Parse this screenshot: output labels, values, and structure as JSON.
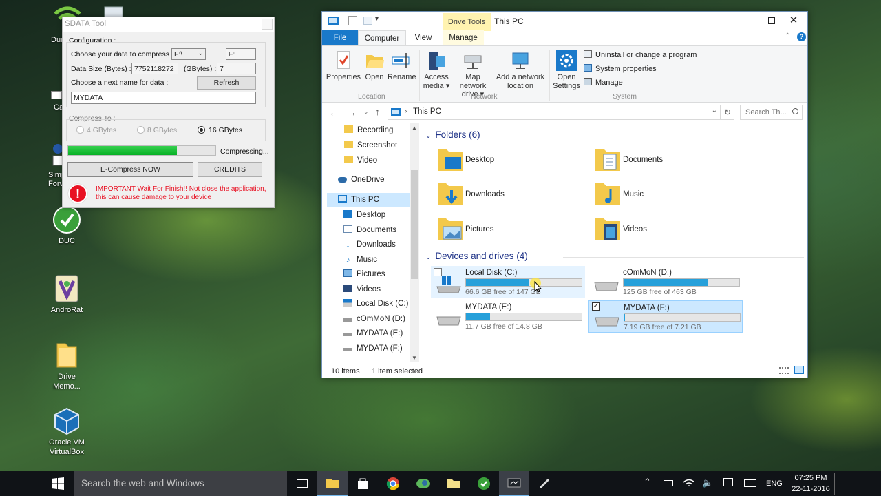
{
  "desktop": {
    "icons": [
      {
        "name": "desktop-icon-duc",
        "label": "DUC"
      },
      {
        "name": "desktop-icon-androrat",
        "label": "AndroRat"
      },
      {
        "name": "desktop-icon-drive-memo",
        "label": "Drive Memo..."
      },
      {
        "name": "desktop-icon-virtualbox",
        "label": "Oracle VM VirtualBox"
      }
    ],
    "clipped_labels": [
      "Dui",
      "Ca",
      "Simp",
      "Forv"
    ]
  },
  "sdata": {
    "title": "SDATA Tool",
    "config_label": "Configuration :",
    "choose_data_label": "Choose your data to compress :",
    "drive_select": "F:\\",
    "drive_box": "F:",
    "data_size_label": "Data Size (Bytes) :",
    "data_size_value": "7752118272",
    "gbytes_label": "(GBytes) :",
    "gbytes_value": "7",
    "next_name_label": "Choose a next name for data :",
    "refresh_label": "Refresh",
    "name_value": "MYDATA",
    "compress_to_label": "Compress To :",
    "options": [
      "4 GBytes",
      "8 GBytes",
      "16 GBytes"
    ],
    "selected_option": "16 GBytes",
    "progress": 0.74,
    "progress_status": "Compressing...",
    "compress_button": "E-Compress NOW",
    "credits_button": "CREDITS",
    "warning": "IMPORTANT Wait For Finish!! Not close the application, this can cause damage to your device",
    "colors": {
      "progress": "#06b025",
      "warning": "#e81123"
    }
  },
  "explorer": {
    "title": "This PC",
    "context_tab": "Drive Tools",
    "tabs": {
      "file": "File",
      "computer": "Computer",
      "view": "View",
      "manage": "Manage"
    },
    "ribbon": {
      "properties": "Properties",
      "open": "Open",
      "rename": "Rename",
      "access_media": "Access media",
      "map_network_drive": "Map network drive",
      "add_network_location": "Add a network location",
      "open_settings": "Open Settings",
      "uninstall": "Uninstall or change a program",
      "system_properties": "System properties",
      "manage": "Manage",
      "group_location": "Location",
      "group_network": "Network",
      "group_system": "System"
    },
    "address": "This PC",
    "search_placeholder": "Search Th...",
    "nav": [
      {
        "label": "Recording",
        "icon": "folder-icon"
      },
      {
        "label": "Screenshot",
        "icon": "folder-icon"
      },
      {
        "label": "Video",
        "icon": "folder-icon"
      },
      {
        "label": "OneDrive",
        "icon": "cloud-icon"
      },
      {
        "label": "This PC",
        "icon": "computer-icon"
      },
      {
        "label": "Desktop",
        "icon": "desktop-icon"
      },
      {
        "label": "Documents",
        "icon": "documents-icon"
      },
      {
        "label": "Downloads",
        "icon": "download-icon"
      },
      {
        "label": "Music",
        "icon": "music-icon"
      },
      {
        "label": "Pictures",
        "icon": "pictures-icon"
      },
      {
        "label": "Videos",
        "icon": "videos-icon"
      },
      {
        "label": "Local Disk (C:)",
        "icon": "disk-icon"
      },
      {
        "label": "cOmMoN (D:)",
        "icon": "drive-icon"
      },
      {
        "label": "MYDATA (E:)",
        "icon": "drive-icon"
      },
      {
        "label": "MYDATA (F:)",
        "icon": "drive-icon"
      }
    ],
    "folders_header": "Folders (6)",
    "folders": [
      {
        "label": "Desktop",
        "icon": "desktop-folder-icon"
      },
      {
        "label": "Documents",
        "icon": "documents-folder-icon"
      },
      {
        "label": "Downloads",
        "icon": "downloads-folder-icon"
      },
      {
        "label": "Music",
        "icon": "music-folder-icon"
      },
      {
        "label": "Pictures",
        "icon": "pictures-folder-icon"
      },
      {
        "label": "Videos",
        "icon": "videos-folder-icon"
      }
    ],
    "drives_header": "Devices and drives (4)",
    "drives": [
      {
        "label": "Local Disk (C:)",
        "free": "66.6 GB free of 147 GB",
        "used_fraction": 0.55
      },
      {
        "label": "cOmMoN (D:)",
        "free": "125 GB free of 463 GB",
        "used_fraction": 0.73
      },
      {
        "label": "MYDATA (E:)",
        "free": "11.7 GB free of 14.8 GB",
        "used_fraction": 0.21
      },
      {
        "label": "MYDATA (F:)",
        "free": "7.19 GB free of 7.21 GB",
        "used_fraction": 0.003
      }
    ],
    "status_items": "10 items",
    "status_selected": "1 item selected",
    "colors": {
      "accent": "#1979ca",
      "bar": "#26a0da",
      "selection": "#cce8ff",
      "context_tab": "#fff3b0"
    }
  },
  "taskbar": {
    "search_placeholder": "Search the web and Windows",
    "language": "ENG",
    "time": "07:25 PM",
    "date": "22-11-2016"
  }
}
